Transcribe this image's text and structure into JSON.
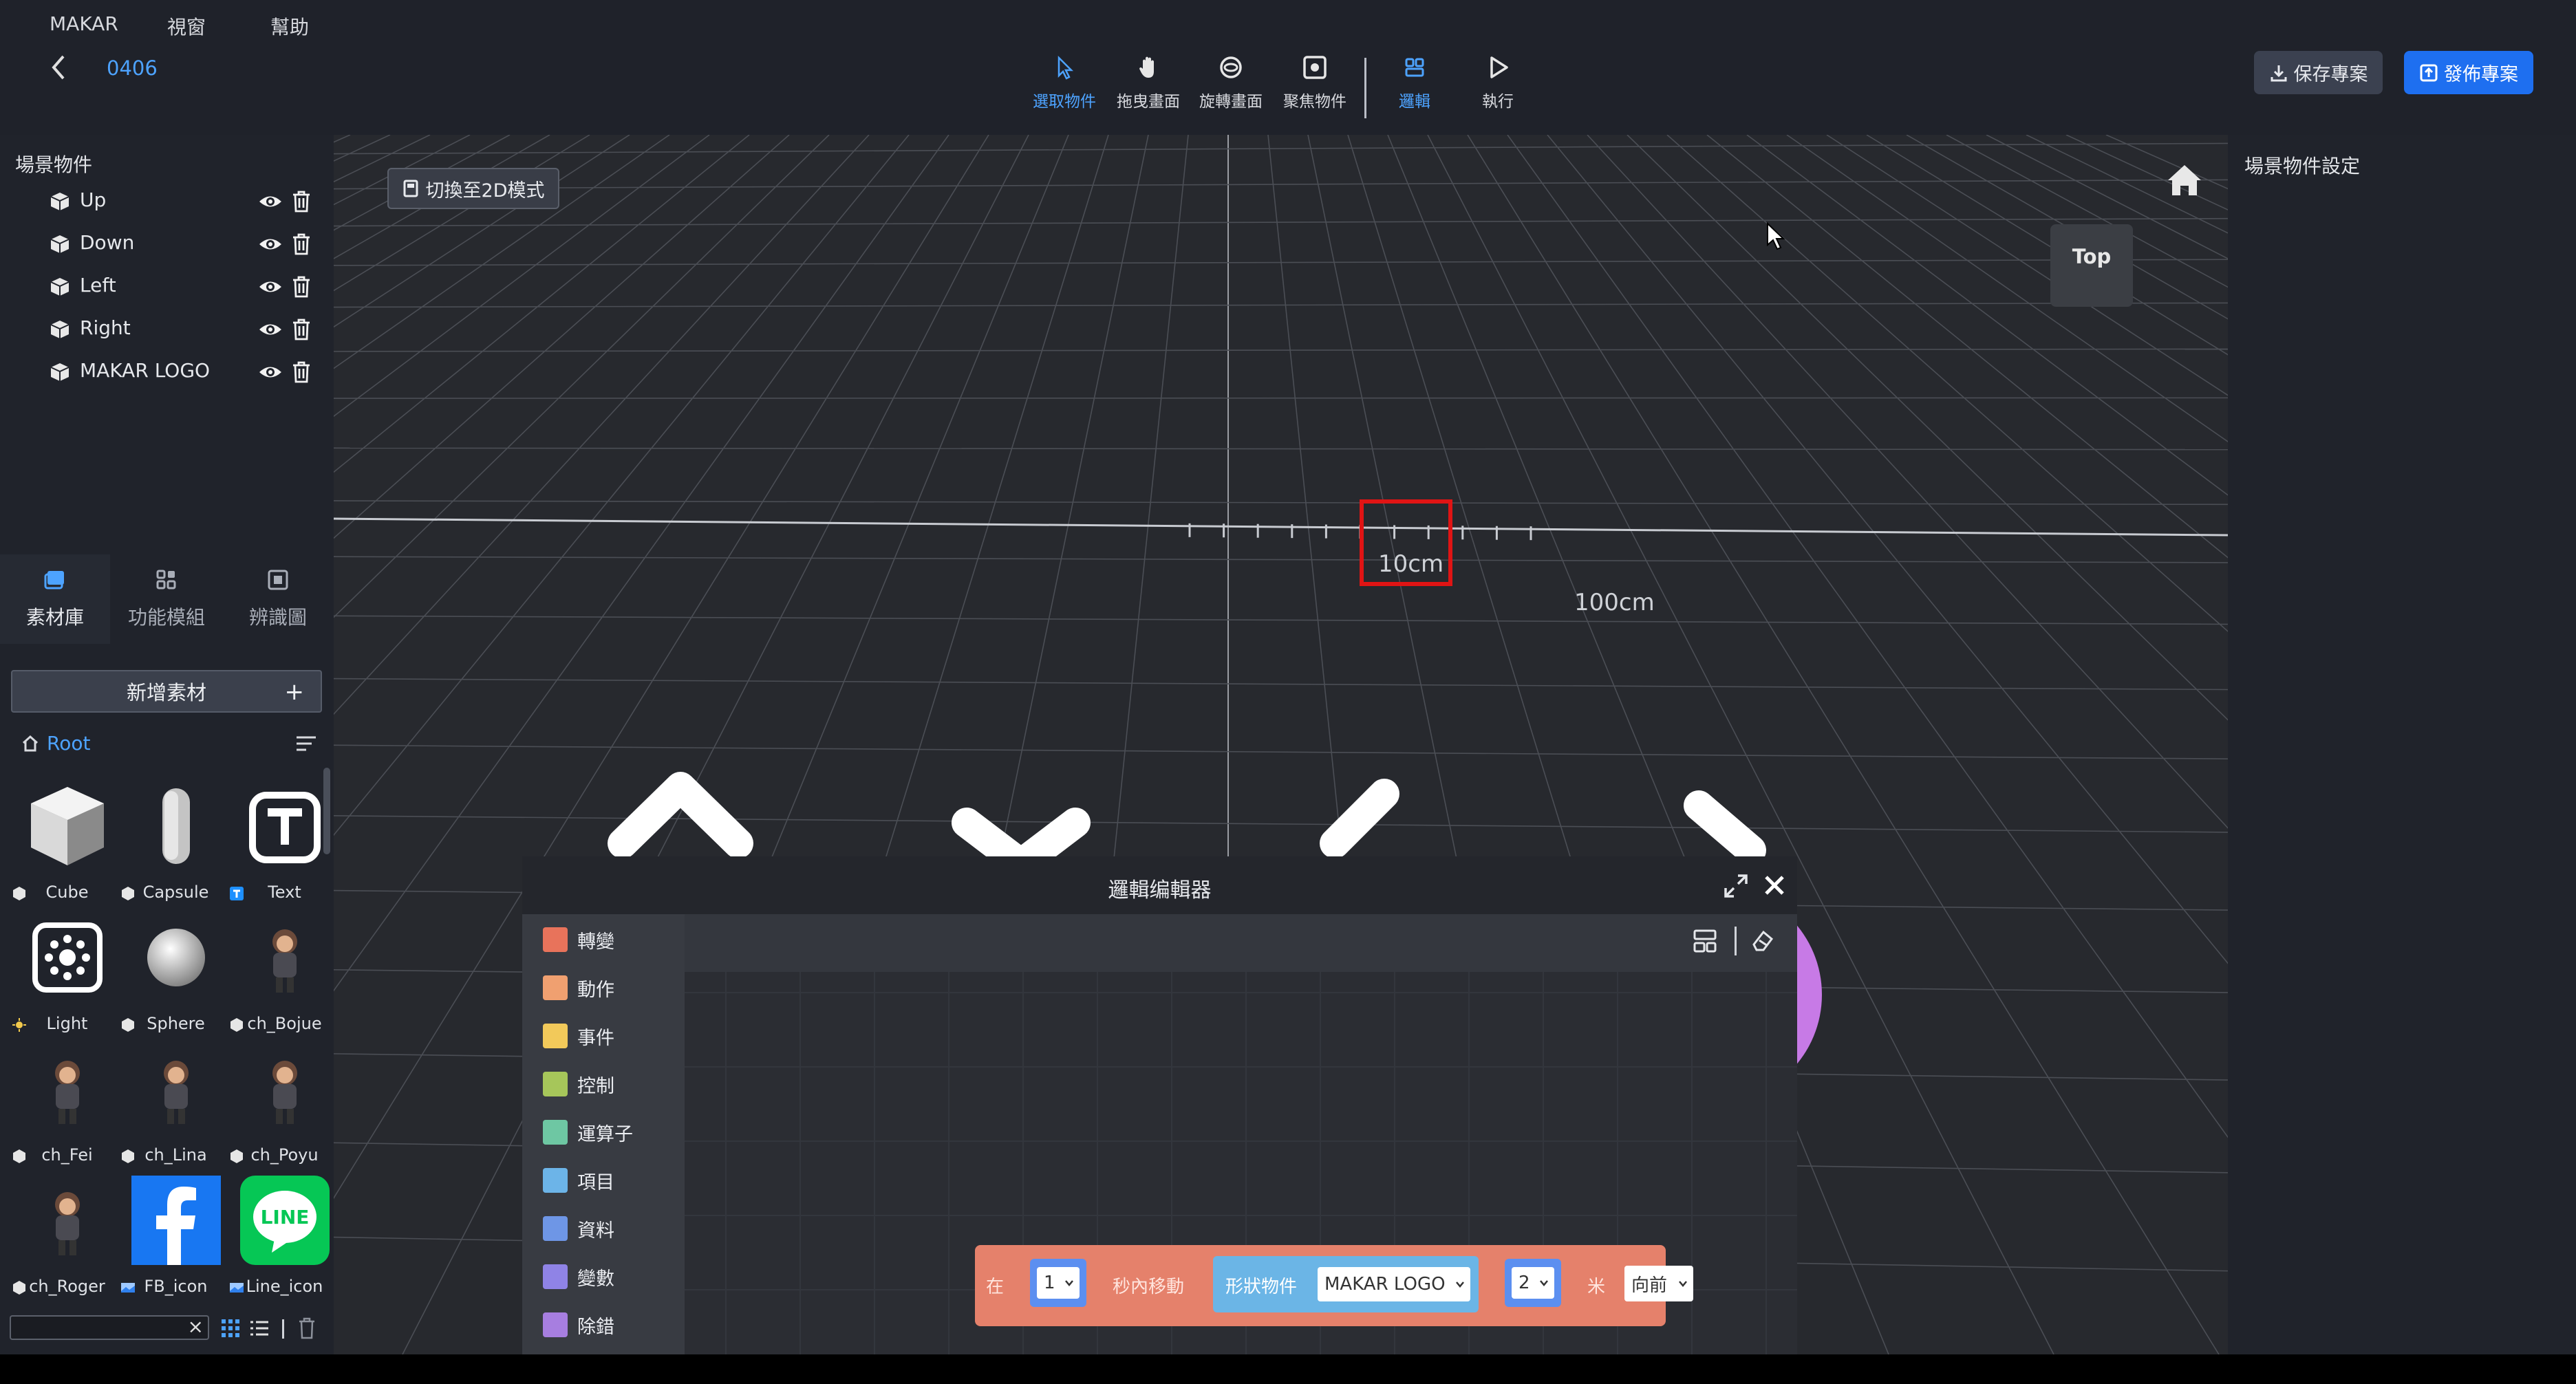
{
  "menu": [
    "MAKAR",
    "視窗",
    "幫助"
  ],
  "project": {
    "name": "0406"
  },
  "toolbar": {
    "tools": [
      {
        "label": "選取物件",
        "icon": "cursor-icon",
        "active": true
      },
      {
        "label": "拖曳畫面",
        "icon": "hand-icon",
        "active": false
      },
      {
        "label": "旋轉畫面",
        "icon": "rotate-icon",
        "active": false
      },
      {
        "label": "聚焦物件",
        "icon": "focus-icon",
        "active": false
      },
      {
        "label": "邏輯",
        "icon": "logic-icon",
        "active": true
      },
      {
        "label": "執行",
        "icon": "play-icon",
        "active": false
      }
    ],
    "save_label": "保存專案",
    "publish_label": "發佈專案"
  },
  "scene": {
    "title": "場景物件",
    "objects": [
      "Up",
      "Down",
      "Left",
      "Right",
      "MAKAR LOGO"
    ]
  },
  "tabs": [
    {
      "label": "素材庫",
      "icon": "asset-library-icon",
      "active": true
    },
    {
      "label": "功能模組",
      "icon": "module-icon",
      "active": false
    },
    {
      "label": "辨識圖",
      "icon": "target-image-icon",
      "active": false
    }
  ],
  "assets": {
    "add_label": "新增素材",
    "root_label": "Root",
    "items": [
      {
        "name": "Cube",
        "icon": "cube-icon"
      },
      {
        "name": "Capsule",
        "icon": "capsule-icon"
      },
      {
        "name": "Text",
        "icon": "text-icon"
      },
      {
        "name": "Light",
        "icon": "light-icon"
      },
      {
        "name": "Sphere",
        "icon": "sphere-icon"
      },
      {
        "name": "ch_Bojue",
        "icon": "character-icon"
      },
      {
        "name": "ch_Fei",
        "icon": "character-icon"
      },
      {
        "name": "ch_Lina",
        "icon": "character-icon"
      },
      {
        "name": "ch_Poyu",
        "icon": "character-icon"
      },
      {
        "name": "ch_Roger",
        "icon": "character-icon"
      },
      {
        "name": "FB_icon",
        "icon": "facebook-icon"
      },
      {
        "name": "Line_icon",
        "icon": "line-icon"
      }
    ],
    "search_value": ""
  },
  "viewport": {
    "mode_button": "切換至2D模式",
    "view_cube_label": "Top",
    "scale_small": "10cm",
    "scale_large": "100cm"
  },
  "right_panel": {
    "title": "場景物件設定"
  },
  "logic_editor": {
    "title": "邏輯编輯器",
    "categories": [
      {
        "label": "轉變",
        "color": "#e8735b"
      },
      {
        "label": "動作",
        "color": "#f0a070"
      },
      {
        "label": "事件",
        "color": "#f2c95a"
      },
      {
        "label": "控制",
        "color": "#a6c65a"
      },
      {
        "label": "運算子",
        "color": "#6ec7a3"
      },
      {
        "label": "項目",
        "color": "#6cb4e8"
      },
      {
        "label": "資料",
        "color": "#6e96e6"
      },
      {
        "label": "變數",
        "color": "#8f83e6"
      },
      {
        "label": "除錯",
        "color": "#a77ee0"
      }
    ],
    "block": {
      "prefix": "在",
      "seconds": "1",
      "move_text": "秒內移動",
      "shape_label": "形狀物件",
      "shape_value": "MAKAR LOGO",
      "distance": "2",
      "unit": "米",
      "direction": "向前"
    }
  },
  "colors": {
    "accent": "#4da3ff",
    "publish": "#1e6ff0",
    "up_circle": "#8fa6ff",
    "down_circle": "#ffb7c9",
    "left_circle": "#b0be0a",
    "right_circle": "#c77ae6"
  }
}
